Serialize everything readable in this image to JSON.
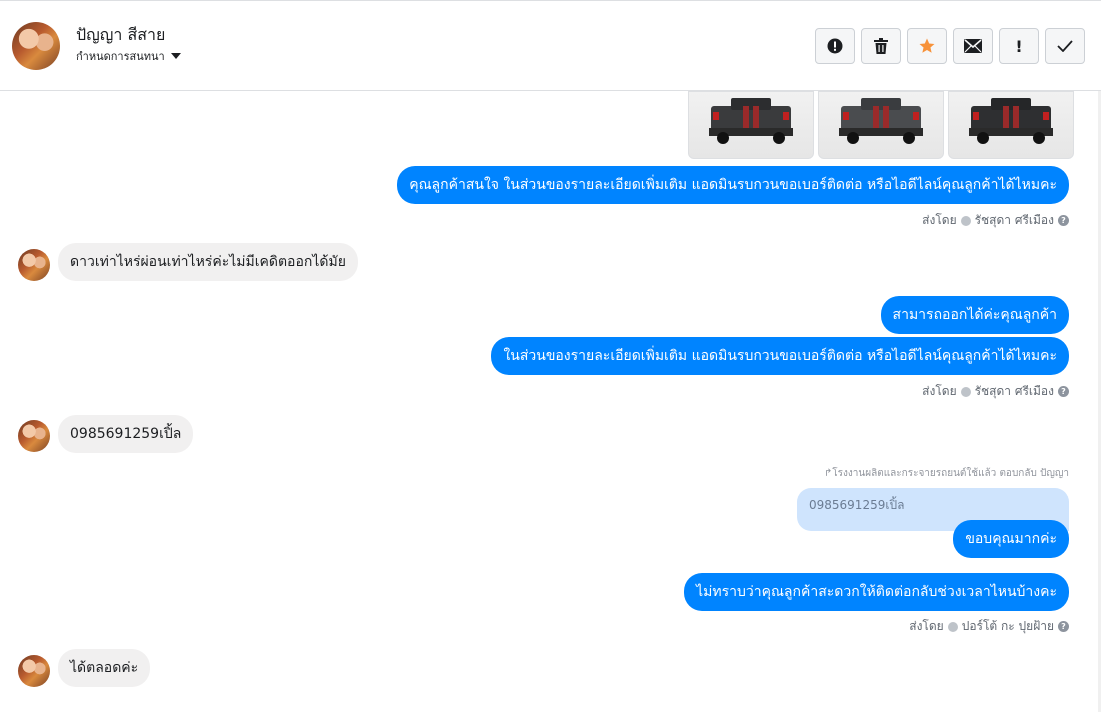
{
  "header": {
    "name": "ปัญญา สีสาย",
    "subtitle": "กำหนดการสนทนา",
    "buttons": [
      {
        "icon": "alert-circle-icon",
        "glyph": "!"
      },
      {
        "icon": "trash-icon",
        "glyph": "🗑"
      },
      {
        "icon": "star-icon",
        "glyph": "★"
      },
      {
        "icon": "envelope-icon",
        "glyph": "✉"
      },
      {
        "icon": "exclamation-icon",
        "glyph": "!"
      },
      {
        "icon": "check-icon",
        "glyph": "✓"
      }
    ]
  },
  "messages": {
    "out1": "คุณลูกค้าสนใจ ในส่วนของรายละเอียดเพิ่มเติม แอดมินรบกวนขอเบอร์ติดต่อ หรือไอดีไลน์คุณลูกค้าได้ไหมคะ",
    "sent1_prefix": "ส่งโดย",
    "sent1_name": "รัชสุดา ศรีเมือง",
    "in1": "ดาวเท่าไหร่ผ่อนเท่าไหร่ค่ะไม่มีเคดิตออกได้มัย",
    "out2": "สามารถออกได้ค่ะคุณลูกค้า",
    "out3": "ในส่วนของรายละเอียดเพิ่มเติม แอดมินรบกวนขอเบอร์ติดต่อ หรือไอดีไลน์คุณลูกค้าได้ไหมคะ",
    "sent2_prefix": "ส่งโดย",
    "sent2_name": "รัชสุดา ศรีเมือง",
    "in2": "0985691259เปิ้ล",
    "reply_note": "↱โรงงานผลิตและกระจายรถยนต์ใช้แล้ว ตอบกลับ ปัญญา",
    "quoted": "0985691259เปิ้ล",
    "out4": "ขอบคุณมากค่ะ",
    "out5": "ไม่ทราบว่าคุณลูกค้าสะดวกให้ติดต่อกลับช่วงเวลาไหนบ้างคะ",
    "sent3_prefix": "ส่งโดย",
    "sent3_name": "ปอร์โต้ กะ ปุยฝ้าย",
    "in3": "ได้ตลอดค่ะ"
  },
  "colors": {
    "outgoing": "#0084ff",
    "incoming": "#f1f0f0",
    "star": "#f7923a"
  }
}
